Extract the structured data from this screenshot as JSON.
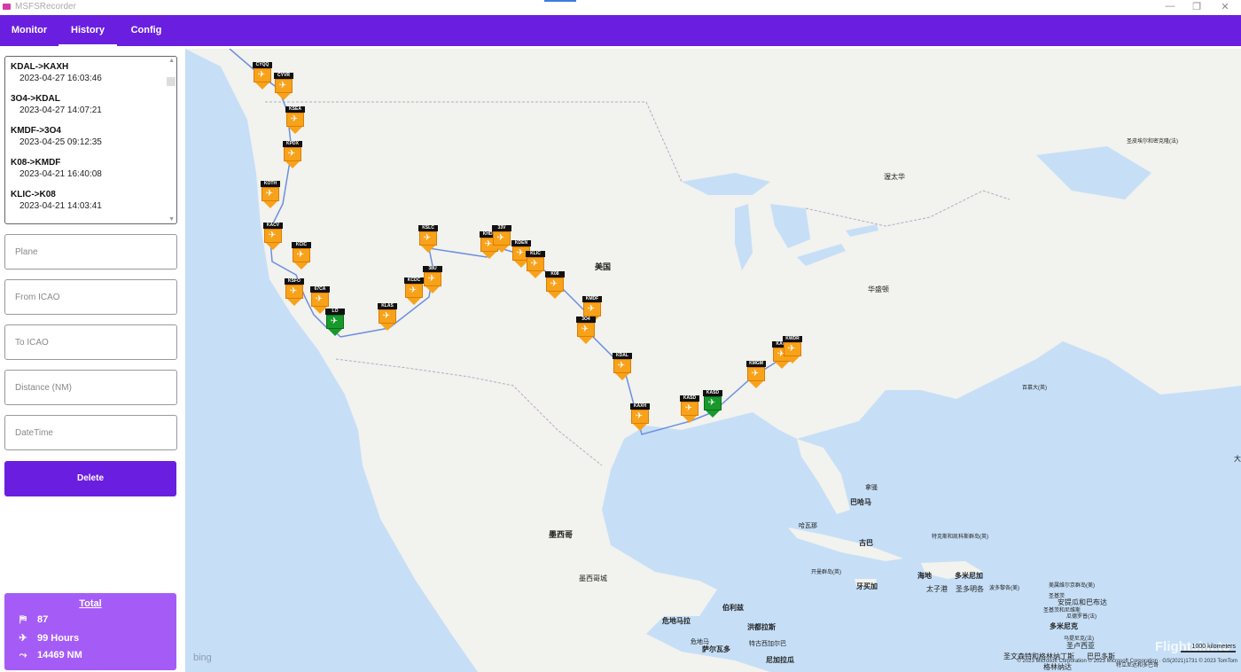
{
  "window": {
    "title": "MSFSRecorder",
    "minimize": "—",
    "maximize": "❐",
    "close": "✕"
  },
  "nav": {
    "tabs": [
      {
        "label": "Monitor"
      },
      {
        "label": "History"
      },
      {
        "label": "Config"
      }
    ],
    "active": "History"
  },
  "history": {
    "items": [
      {
        "route": "KDAL->KAXH",
        "time": "2023-04-27 16:03:46"
      },
      {
        "route": "3O4->KDAL",
        "time": "2023-04-27 14:07:21"
      },
      {
        "route": "KMDF->3O4",
        "time": "2023-04-25 09:12:35"
      },
      {
        "route": "K08->KMDF",
        "time": "2023-04-21 16:40:08"
      },
      {
        "route": "KLIC->K08",
        "time": "2023-04-21 14:03:41"
      }
    ]
  },
  "form": {
    "plane_placeholder": "Plane",
    "from_placeholder": "From ICAO",
    "to_placeholder": "To ICAO",
    "distance_placeholder": "Distance (NM)",
    "datetime_placeholder": "DateTime",
    "delete_label": "Delete"
  },
  "totals": {
    "title": "Total",
    "flights": "87",
    "hours": "99 Hours",
    "distance": "14469 NM",
    "flights_icon": "plane-count-icon",
    "hours_icon": "clock-icon",
    "distance_icon": "route-icon"
  },
  "map": {
    "labels": {
      "usa": "美国",
      "mexico": "墨西哥",
      "mexico_city": "墨西哥城",
      "washington": "华盛顿",
      "ottawa": "渥太华",
      "bahamas": "巴哈马",
      "nassau": "拿骚",
      "havana": "哈瓦那",
      "cuba": "古巴",
      "haiti": "海地",
      "dominican": "多米尼加",
      "jamaica": "牙买加",
      "belize": "伯利兹",
      "guatemala": "危地马拉",
      "honduras": "洪都拉斯",
      "el_salvador": "萨尔瓦多",
      "nicaragua": "尼加拉瓜",
      "bermuda": "百慕大(英)",
      "cayman": "开曼群岛(英)",
      "turks": "特克斯和凯科斯群岛(英)",
      "port_au_prince": "太子港",
      "santo_domingo": "圣多明各",
      "puerto_rico": "波多黎各(美)",
      "virgin": "美属维尔京群岛(美)",
      "antigua": "安提瓜和巴布达",
      "guadeloupe": "瓜德罗普(法)",
      "dominica": "多米尼克",
      "martinique": "马提尼克(法)",
      "st_lucia": "圣卢西亚",
      "st_vincent": "圣文森特和格林纳丁斯",
      "barbados": "巴巴多斯",
      "grenada": "格林纳达",
      "st_kitts": "圣基茨",
      "anguilla": "圣基茨和尼维斯",
      "tegucigalpa": "特古西加尔巴",
      "guatemala_city": "危地马",
      "st_pierre": "圣皮埃尔和密克隆(法)",
      "trinidad": "特立尼达和多巴哥",
      "east": "大",
      "bing": "bing",
      "copyright": "© 2023 Microsoft Corporation  © 2023 Microsoft Corporation · GS(2021)1731   © 2023 TomTom",
      "scale": "1000 kilometers",
      "watermark": "Flightsim.to"
    },
    "airports": [
      {
        "code": "CYQQ",
        "color": "orange"
      },
      {
        "code": "CYVR",
        "color": "orange"
      },
      {
        "code": "KSEA",
        "color": "orange"
      },
      {
        "code": "KPDX",
        "color": "orange"
      },
      {
        "code": "KOTH",
        "color": "orange"
      },
      {
        "code": "KACV",
        "color": "orange"
      },
      {
        "code": "KCIC",
        "color": "orange"
      },
      {
        "code": "KSFO",
        "color": "orange"
      },
      {
        "code": "67CA",
        "color": "orange"
      },
      {
        "code": "LO",
        "color": "green"
      },
      {
        "code": "KLAS",
        "color": "orange"
      },
      {
        "code": "KCDC",
        "color": "orange"
      },
      {
        "code": "38U",
        "color": "orange"
      },
      {
        "code": "KSLC",
        "color": "orange"
      },
      {
        "code": "KHDN",
        "color": "orange"
      },
      {
        "code": "33V",
        "color": "orange"
      },
      {
        "code": "KDEN",
        "color": "orange"
      },
      {
        "code": "KLIC",
        "color": "orange"
      },
      {
        "code": "K08",
        "color": "orange"
      },
      {
        "code": "KMDF",
        "color": "orange"
      },
      {
        "code": "3O4",
        "color": "orange"
      },
      {
        "code": "KDAL",
        "color": "orange"
      },
      {
        "code": "KAXH",
        "color": "orange"
      },
      {
        "code": "KASD",
        "color": "orange"
      },
      {
        "code": "KASD",
        "color": "green"
      },
      {
        "code": "KMGM",
        "color": "orange"
      },
      {
        "code": "KATL",
        "color": "orange"
      },
      {
        "code": "KWDR",
        "color": "orange"
      }
    ]
  },
  "colors": {
    "accent": "#6a1fe0",
    "total_card": "#a55cf7",
    "route": "#6b8fe0",
    "marker": "#f7a21b",
    "marker_green": "#17992b",
    "water": "#c6dff7",
    "land": "#f2f2ee"
  }
}
